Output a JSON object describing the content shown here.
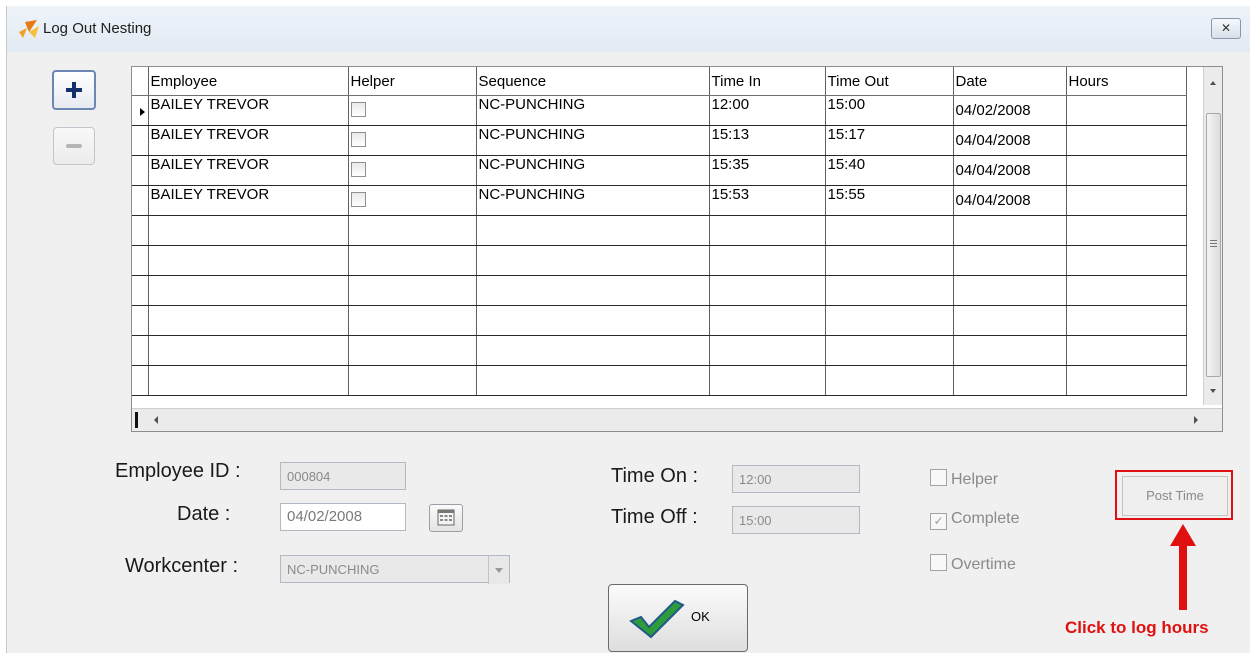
{
  "window": {
    "title": "Log Out Nesting",
    "close_label": "✕"
  },
  "grid": {
    "columns": [
      "Employee",
      "Helper",
      "Sequence",
      "Time In",
      "Time Out",
      "Date",
      "Hours"
    ],
    "rows": [
      {
        "employee": "BAILEY TREVOR",
        "helper": false,
        "sequence": "NC-PUNCHING",
        "time_in": "12:00",
        "time_out": "15:00",
        "date": "04/02/2008",
        "hours": ""
      },
      {
        "employee": "BAILEY TREVOR",
        "helper": false,
        "sequence": "NC-PUNCHING",
        "time_in": "15:13",
        "time_out": "15:17",
        "date": "04/04/2008",
        "hours": ""
      },
      {
        "employee": "BAILEY TREVOR",
        "helper": false,
        "sequence": "NC-PUNCHING",
        "time_in": "15:35",
        "time_out": "15:40",
        "date": "04/04/2008",
        "hours": ""
      },
      {
        "employee": "BAILEY TREVOR",
        "helper": false,
        "sequence": "NC-PUNCHING",
        "time_in": "15:53",
        "time_out": "15:55",
        "date": "04/04/2008",
        "hours": ""
      }
    ]
  },
  "form": {
    "employee_id_label": "Employee ID :",
    "employee_id_value": "000804",
    "date_label": "Date :",
    "date_value": "04/02/2008",
    "workcenter_label": "Workcenter :",
    "workcenter_value": "NC-PUNCHING",
    "time_on_label": "Time On :",
    "time_on_value": "12:00",
    "time_off_label": "Time Off :",
    "time_off_value": "15:00"
  },
  "options": {
    "helper_label": "Helper",
    "complete_label": "Complete",
    "overtime_label": "Overtime",
    "complete_checked": true
  },
  "buttons": {
    "post_time": "Post Time",
    "ok": "OK"
  },
  "annotation": {
    "text": "Click to log hours",
    "color": "#e01010"
  }
}
